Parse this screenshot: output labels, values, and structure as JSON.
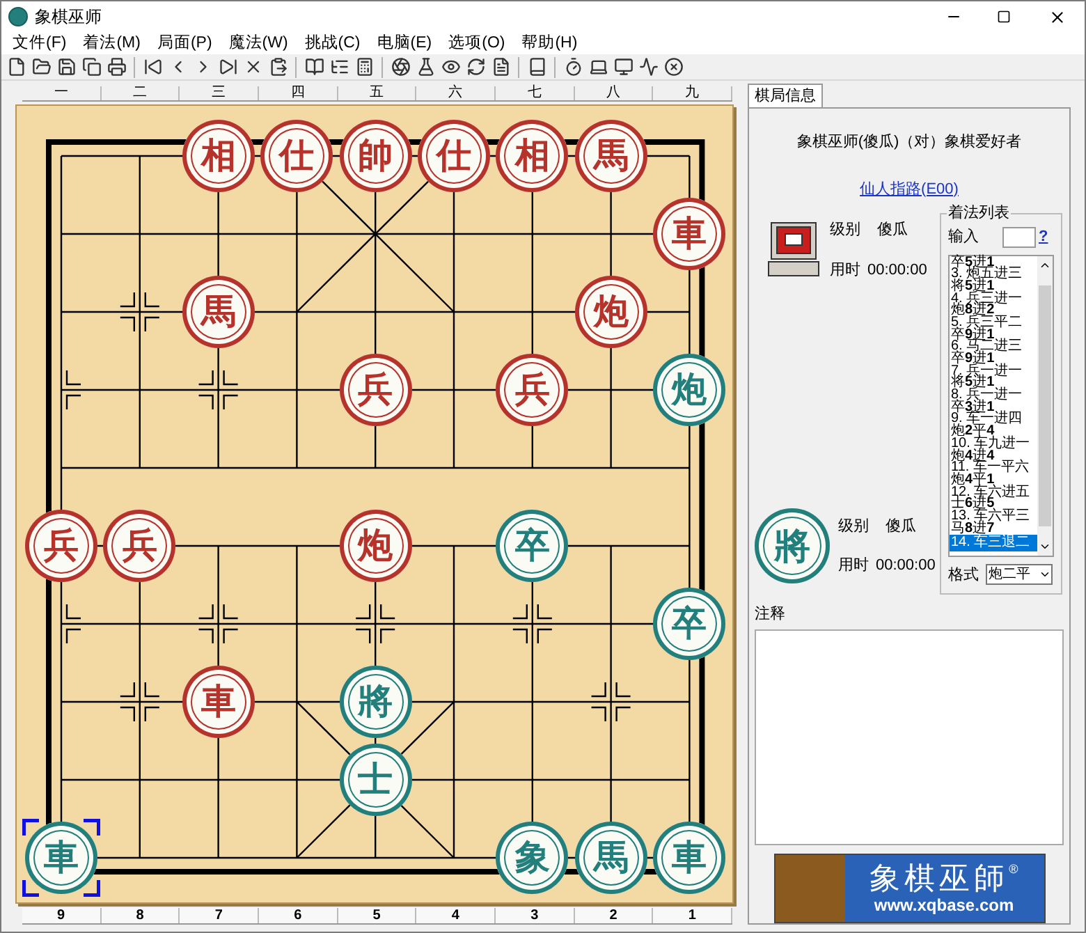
{
  "window": {
    "title": "象棋巫师"
  },
  "menu": [
    "文件(F)",
    "着法(M)",
    "局面(P)",
    "魔法(W)",
    "挑战(C)",
    "电脑(E)",
    "选项(O)",
    "帮助(H)"
  ],
  "board": {
    "top_labels": [
      "一",
      "二",
      "三",
      "四",
      "五",
      "六",
      "七",
      "八",
      "九"
    ],
    "bottom_labels": [
      "9",
      "8",
      "7",
      "6",
      "5",
      "4",
      "3",
      "2",
      "1"
    ],
    "ranks": [
      [
        {
          "kind": "empty"
        },
        {
          "kind": "empty"
        },
        {
          "kind": "piece",
          "char": "相",
          "color": "#b5332b",
          "selected": false
        },
        {
          "kind": "piece",
          "char": "仕",
          "color": "#b5332b",
          "selected": false
        },
        {
          "kind": "piece",
          "char": "帥",
          "color": "#b5332b",
          "selected": false
        },
        {
          "kind": "piece",
          "char": "仕",
          "color": "#b5332b",
          "selected": false
        },
        {
          "kind": "piece",
          "char": "相",
          "color": "#b5332b",
          "selected": false
        },
        {
          "kind": "piece",
          "char": "馬",
          "color": "#b5332b",
          "selected": false
        },
        {
          "kind": "empty"
        }
      ],
      [
        {
          "kind": "empty"
        },
        {
          "kind": "empty"
        },
        {
          "kind": "empty"
        },
        {
          "kind": "empty"
        },
        {
          "kind": "empty"
        },
        {
          "kind": "empty"
        },
        {
          "kind": "empty"
        },
        {
          "kind": "empty"
        },
        {
          "kind": "piece",
          "char": "車",
          "color": "#b5332b",
          "selected": false
        }
      ],
      [
        {
          "kind": "empty"
        },
        {
          "kind": "empty"
        },
        {
          "kind": "piece",
          "char": "馬",
          "color": "#b5332b",
          "selected": false
        },
        {
          "kind": "empty"
        },
        {
          "kind": "empty"
        },
        {
          "kind": "empty"
        },
        {
          "kind": "empty"
        },
        {
          "kind": "piece",
          "char": "炮",
          "color": "#b5332b",
          "selected": false
        },
        {
          "kind": "empty"
        }
      ],
      [
        {
          "kind": "empty"
        },
        {
          "kind": "empty"
        },
        {
          "kind": "empty"
        },
        {
          "kind": "empty"
        },
        {
          "kind": "piece",
          "char": "兵",
          "color": "#b5332b",
          "selected": false
        },
        {
          "kind": "empty"
        },
        {
          "kind": "piece",
          "char": "兵",
          "color": "#b5332b",
          "selected": false
        },
        {
          "kind": "empty"
        },
        {
          "kind": "piece",
          "char": "炮",
          "color": "#237f7b",
          "selected": false
        }
      ],
      [
        {
          "kind": "empty"
        },
        {
          "kind": "empty"
        },
        {
          "kind": "empty"
        },
        {
          "kind": "empty"
        },
        {
          "kind": "empty"
        },
        {
          "kind": "empty"
        },
        {
          "kind": "empty"
        },
        {
          "kind": "empty"
        },
        {
          "kind": "empty"
        }
      ],
      [
        {
          "kind": "piece",
          "char": "兵",
          "color": "#b5332b",
          "selected": false
        },
        {
          "kind": "piece",
          "char": "兵",
          "color": "#b5332b",
          "selected": false
        },
        {
          "kind": "empty"
        },
        {
          "kind": "empty"
        },
        {
          "kind": "piece",
          "char": "炮",
          "color": "#b5332b",
          "selected": false
        },
        {
          "kind": "empty"
        },
        {
          "kind": "piece",
          "char": "卒",
          "color": "#237f7b",
          "selected": false
        },
        {
          "kind": "empty"
        },
        {
          "kind": "empty"
        }
      ],
      [
        {
          "kind": "empty"
        },
        {
          "kind": "empty"
        },
        {
          "kind": "empty"
        },
        {
          "kind": "empty"
        },
        {
          "kind": "empty"
        },
        {
          "kind": "empty"
        },
        {
          "kind": "empty"
        },
        {
          "kind": "empty"
        },
        {
          "kind": "piece",
          "char": "卒",
          "color": "#237f7b",
          "selected": false
        }
      ],
      [
        {
          "kind": "empty"
        },
        {
          "kind": "empty"
        },
        {
          "kind": "piece",
          "char": "車",
          "color": "#b5332b",
          "selected": false
        },
        {
          "kind": "empty"
        },
        {
          "kind": "piece",
          "char": "將",
          "color": "#237f7b",
          "selected": false
        },
        {
          "kind": "empty"
        },
        {
          "kind": "empty"
        },
        {
          "kind": "empty"
        },
        {
          "kind": "empty"
        }
      ],
      [
        {
          "kind": "empty"
        },
        {
          "kind": "empty"
        },
        {
          "kind": "empty"
        },
        {
          "kind": "empty"
        },
        {
          "kind": "piece",
          "char": "士",
          "color": "#237f7b",
          "selected": false
        },
        {
          "kind": "empty"
        },
        {
          "kind": "empty"
        },
        {
          "kind": "empty"
        },
        {
          "kind": "empty"
        }
      ],
      [
        {
          "kind": "piece",
          "char": "車",
          "color": "#237f7b",
          "selected": true
        },
        {
          "kind": "empty"
        },
        {
          "kind": "empty"
        },
        {
          "kind": "empty"
        },
        {
          "kind": "empty"
        },
        {
          "kind": "empty"
        },
        {
          "kind": "piece",
          "char": "象",
          "color": "#237f7b",
          "selected": false
        },
        {
          "kind": "piece",
          "char": "馬",
          "color": "#237f7b",
          "selected": false
        },
        {
          "kind": "piece",
          "char": "車",
          "color": "#237f7b",
          "selected": false
        }
      ]
    ]
  },
  "info_panel": {
    "tab": "棋局信息",
    "matchup": "象棋巫师(傻瓜)（对）象棋爱好者",
    "opening_link": "仙人指路(E00)",
    "players": [
      {
        "kind": "computer",
        "rank_label": "级别",
        "rank_value": "傻瓜",
        "time_label": "用时",
        "time_value": "00:00:00"
      },
      {
        "kind": "piece",
        "avatar": "將",
        "rank_label": "级别",
        "rank_value": "傻瓜",
        "time_label": "用时",
        "time_value": "00:00:00"
      }
    ],
    "move_list": {
      "title": "着法列表",
      "input_label": "输入",
      "help_link": "?",
      "format_label": "格式",
      "format_value": "炮二平",
      "moves": [
        {
          "text": "卒**5**进**1**",
          "selected": false
        },
        {
          "text": "3. 炮五进三",
          "selected": false
        },
        {
          "text": "将**5**进**1**",
          "selected": false
        },
        {
          "text": "4. 兵三进一",
          "selected": false
        },
        {
          "text": "炮**8**进**2**",
          "selected": false
        },
        {
          "text": "5. 兵三平二",
          "selected": false
        },
        {
          "text": "卒**9**进**1**",
          "selected": false
        },
        {
          "text": "6. 马二进三",
          "selected": false
        },
        {
          "text": "卒**9**进**1**",
          "selected": false
        },
        {
          "text": "7. 兵一进一",
          "selected": false
        },
        {
          "text": "将**5**进**1**",
          "selected": false
        },
        {
          "text": "8. 兵一进一",
          "selected": false
        },
        {
          "text": "卒**3**进**1**",
          "selected": false
        },
        {
          "text": "9. 车一进四",
          "selected": false
        },
        {
          "text": "炮**2**平**4**",
          "selected": false
        },
        {
          "text": "10. 车九进一",
          "selected": false
        },
        {
          "text": "炮**4**进**4**",
          "selected": false
        },
        {
          "text": "11. 车一平六",
          "selected": false
        },
        {
          "text": "炮**4**平**1**",
          "selected": false
        },
        {
          "text": "12. 车六进五",
          "selected": false
        },
        {
          "text": "士**6**进**5**",
          "selected": false
        },
        {
          "text": "13. 车六平三",
          "selected": false
        },
        {
          "text": "马**8**进**7**",
          "selected": false
        },
        {
          "text": "14. 车三退二",
          "selected": true
        }
      ]
    },
    "notes_label": "注释",
    "banner": {
      "title": "象棋巫師",
      "mark": "®",
      "url": "www.xqbase.com"
    }
  }
}
